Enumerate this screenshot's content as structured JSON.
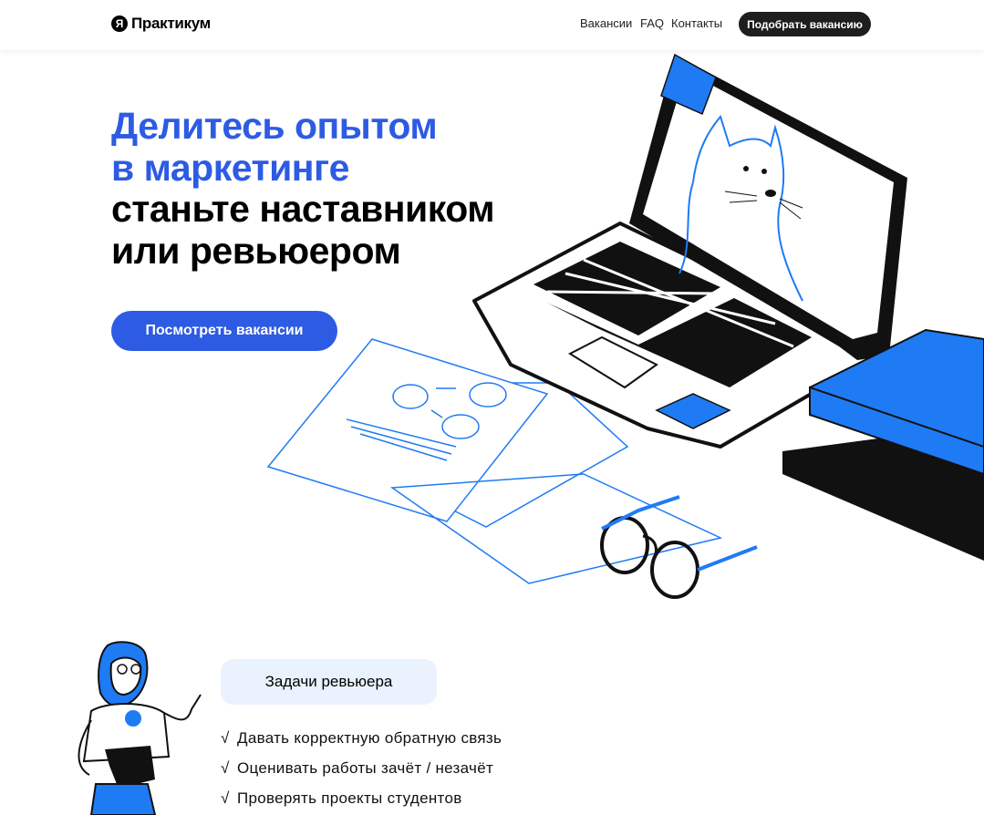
{
  "header": {
    "logo_mark": "Я",
    "logo_text": "Практикум",
    "nav": [
      "Вакансии",
      "FAQ",
      "Контакты"
    ],
    "cta_label": "Подобрать вакансию"
  },
  "hero": {
    "title_blue_1": "Делитесь опытом",
    "title_blue_2": "в маркетинге",
    "title_black_1": "станьте наставником",
    "title_black_2": "или ревьюером",
    "button_label": "Посмотреть вакансии"
  },
  "tasks": {
    "heading": "Задачи ревьюера",
    "check": "√",
    "items": [
      "Давать корректную обратную связь",
      "Оценивать работы зачёт / незачёт",
      "Проверять проекты студентов"
    ]
  },
  "colors": {
    "accent": "#2d5be3",
    "illustration_blue": "#1f7bf4",
    "pill_bg": "#e9f2fd",
    "dark_button": "#1e1e1e"
  },
  "icons": {
    "logo": "yandex-logo-icon",
    "illustration": "laptop-cat-illustration",
    "character": "girl-pointing-illustration"
  }
}
